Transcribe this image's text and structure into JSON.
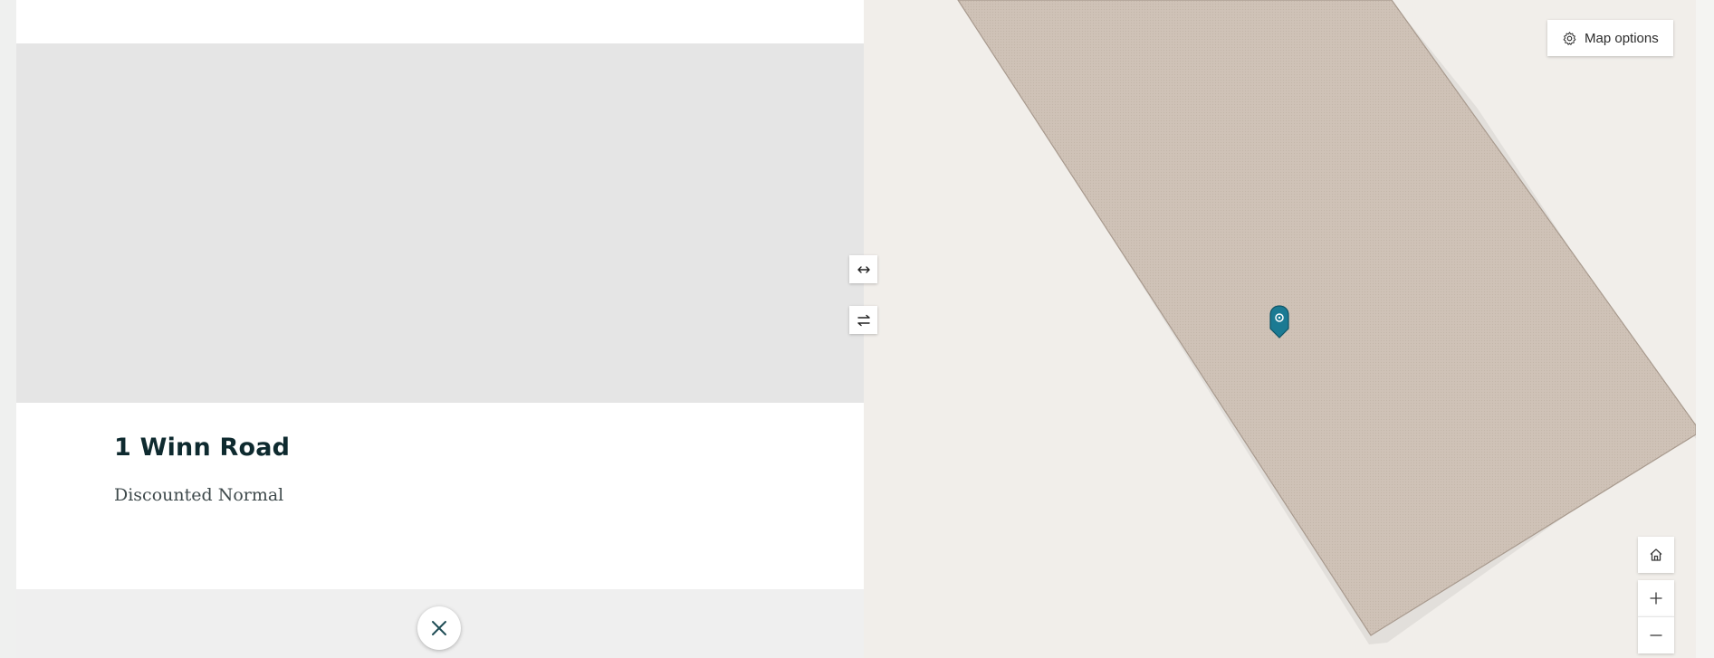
{
  "feature": {
    "title": "1 Winn Road",
    "subtitle": "Discounted Normal"
  },
  "map": {
    "options_label": "Map options",
    "colors": {
      "background": "#f1eeea",
      "parcel_fill": "#cfc2b7",
      "parcel_outline": "#a89a8e",
      "marker": "#1b7a93"
    }
  },
  "icons": {
    "close": "close-icon",
    "expand": "horizontal-arrows-icon",
    "swap": "swap-arrows-icon",
    "map_options": "gear-icon",
    "home": "home-icon",
    "zoom_in": "plus-icon",
    "zoom_out": "minus-icon",
    "marker": "location-pin-icon"
  }
}
